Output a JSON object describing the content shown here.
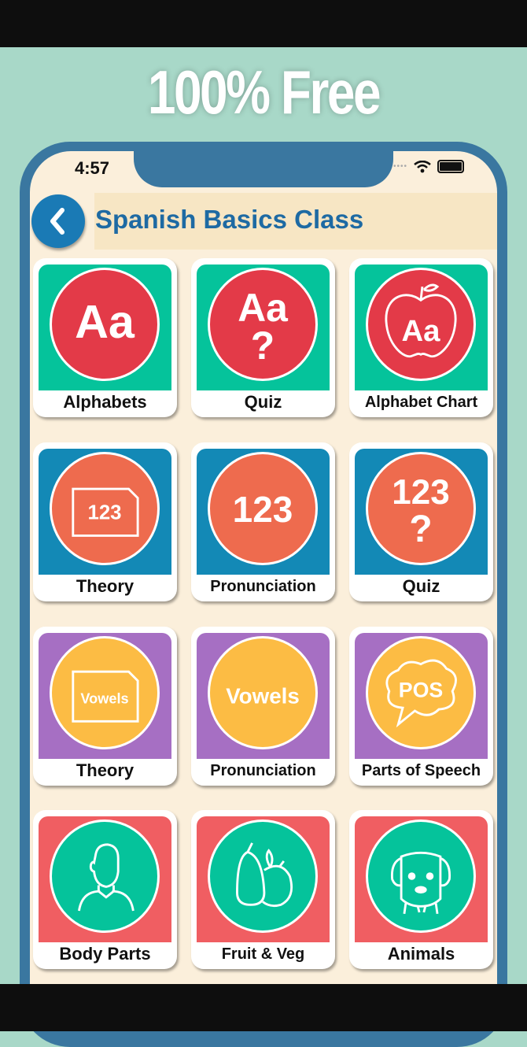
{
  "promo": {
    "headline": "100% Free"
  },
  "status_bar": {
    "time": "4:57",
    "wifi_icon": "wifi-icon",
    "battery_icon": "battery-icon"
  },
  "header": {
    "title": "Spanish Basics Class",
    "back_icon": "chevron-left-icon"
  },
  "colors": {
    "accent": "#1a7ab5",
    "title": "#1e6aa3",
    "screen_bg": "#fbefdb",
    "frame": "#3a77a0"
  },
  "tiles": [
    {
      "label": "Alphabets",
      "icon": "alphabet-icon",
      "icon_text": "Aa",
      "bg": "#05c39b",
      "circle": "#e33a48"
    },
    {
      "label": "Quiz",
      "icon": "alphabet-quiz-icon",
      "icon_text": "Aa",
      "bg": "#05c39b",
      "circle": "#e33a48"
    },
    {
      "label": "Alphabet Chart",
      "icon": "apple-alphabet-icon",
      "icon_text": "Aa",
      "bg": "#05c39b",
      "circle": "#e33a48"
    },
    {
      "label": "Theory",
      "icon": "numbers-document-icon",
      "icon_text": "123",
      "bg": "#1389b6",
      "circle": "#ee6b4e"
    },
    {
      "label": "Pronunciation",
      "icon": "numbers-icon",
      "icon_text": "123",
      "bg": "#1389b6",
      "circle": "#ee6b4e"
    },
    {
      "label": "Quiz",
      "icon": "numbers-quiz-icon",
      "icon_text": "123",
      "bg": "#1389b6",
      "circle": "#ee6b4e"
    },
    {
      "label": "Theory",
      "icon": "vowels-document-icon",
      "icon_text": "Vowels",
      "bg": "#a66fc3",
      "circle": "#fcbc44"
    },
    {
      "label": "Pronunciation",
      "icon": "vowels-icon",
      "icon_text": "Vowels",
      "bg": "#a66fc3",
      "circle": "#fcbc44"
    },
    {
      "label": "Parts of Speech",
      "icon": "speech-bubble-icon",
      "icon_text": "POS",
      "bg": "#a66fc3",
      "circle": "#fcbc44"
    },
    {
      "label": "Body Parts",
      "icon": "person-icon",
      "icon_text": "",
      "bg": "#f05e62",
      "circle": "#05c39b"
    },
    {
      "label": "Fruit & Veg",
      "icon": "fruit-icon",
      "icon_text": "",
      "bg": "#f05e62",
      "circle": "#05c39b"
    },
    {
      "label": "Animals",
      "icon": "dog-icon",
      "icon_text": "",
      "bg": "#f05e62",
      "circle": "#05c39b"
    }
  ]
}
